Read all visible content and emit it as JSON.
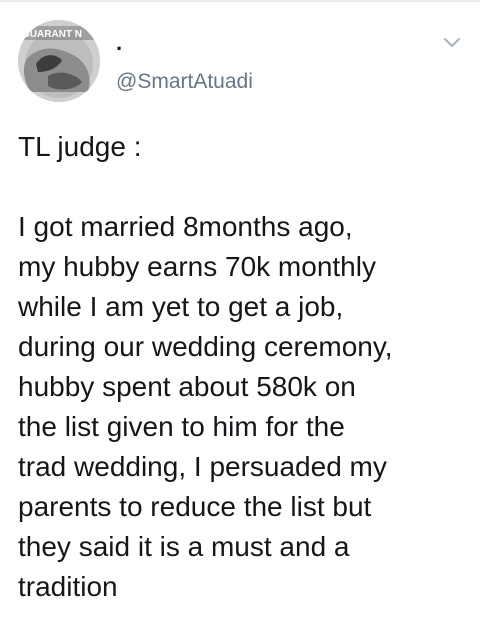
{
  "author": {
    "display_name": ".",
    "handle": "@SmartAtuadi",
    "avatar_caption": "GUARANT N"
  },
  "menu": {
    "icon": "chevron-down-icon"
  },
  "tweet": {
    "title": "TL judge :",
    "lines": [
      "I got married 8months ago,",
      "my hubby earns 70k monthly",
      "while I am yet to get a job,",
      "during our wedding ceremony,",
      "hubby spent about 580k on",
      "the list given to him for the",
      "trad wedding, I persuaded my",
      "parents to reduce the list but",
      "they said it is a must and a",
      "tradition"
    ]
  }
}
